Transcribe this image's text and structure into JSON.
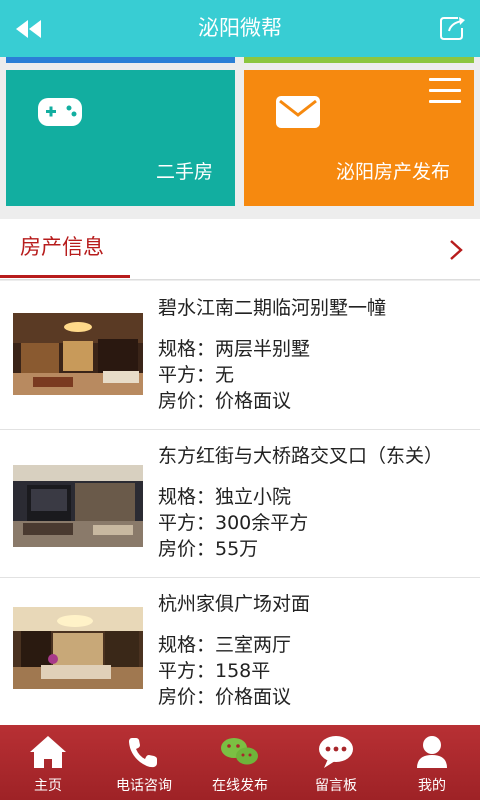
{
  "header": {
    "title": "泌阳微帮"
  },
  "tiles": [
    {
      "label": "二手房",
      "icon": "gamepad-icon"
    },
    {
      "label": "泌阳房产发布",
      "icon": "mail-icon"
    }
  ],
  "section": {
    "title": "房产信息"
  },
  "listings": [
    {
      "title": "碧水江南二期临河别墅一幢",
      "spec": "规格：两层半别墅",
      "area": "平方：无",
      "price": "房价：价格面议"
    },
    {
      "title": "东方红街与大桥路交叉口（东关）",
      "spec": "规格：独立小院",
      "area": "平方：300余平方",
      "price": "房价：55万"
    },
    {
      "title": "杭州家俱广场对面",
      "spec": "规格：三室两厅",
      "area": "平方：158平",
      "price": "房价：价格面议"
    }
  ],
  "bottom_nav": [
    {
      "label": "主页",
      "icon": "home-icon"
    },
    {
      "label": "电话咨询",
      "icon": "phone-icon"
    },
    {
      "label": "在线发布",
      "icon": "wechat-icon"
    },
    {
      "label": "留言板",
      "icon": "chat-bubble-icon"
    },
    {
      "label": "我的",
      "icon": "user-icon"
    }
  ],
  "colors": {
    "topbar": "#38cdd3",
    "tile_teal": "#12aea0",
    "tile_orange": "#f6890f",
    "accent_red": "#b71c1c",
    "bottom_nav": "#a8262a"
  }
}
